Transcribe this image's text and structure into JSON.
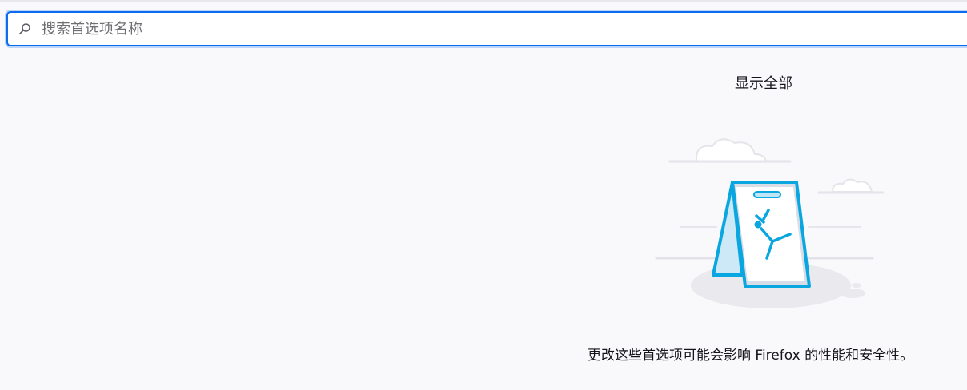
{
  "search": {
    "placeholder": "搜索首选项名称",
    "value": ""
  },
  "actions": {
    "show_all_label": "显示全部"
  },
  "warning": {
    "text": "更改这些首选项可能会影响 Firefox 的性能和安全性。"
  },
  "icons": {
    "search": "search-icon",
    "illustration": "wet-floor-warning-illustration"
  },
  "colors": {
    "accent": "#0b6cf0",
    "illustration_blue": "#0aa6e0",
    "background": "#f9f9fb"
  }
}
